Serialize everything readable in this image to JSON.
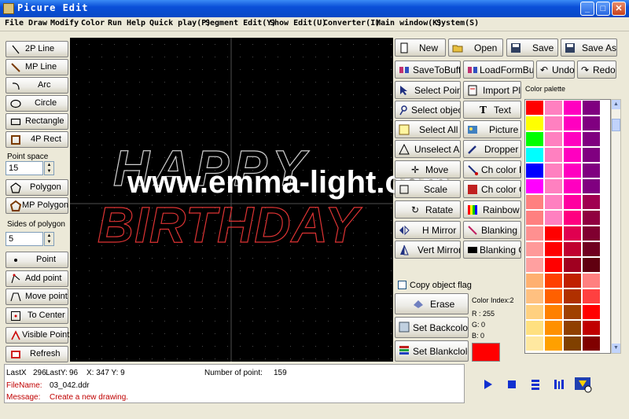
{
  "window": {
    "title": "Picure Edit",
    "minimize": "_",
    "maximize": "□",
    "close": "✕"
  },
  "menu": [
    "File",
    "Draw",
    "Modify",
    "Color",
    "Run",
    "Help",
    "Quick play(P)",
    "Segment Edit(Y)",
    "Show Edit(U)",
    "Converter(I)",
    "Main window(K)",
    "System(S)"
  ],
  "left_tools": {
    "line2p": "2P Line",
    "mpline": "MP Line",
    "arc": "Arc",
    "circle": "Circle",
    "rectangle": "Rectangle",
    "rect4p": "4P Rect",
    "point_space_label": "Point space",
    "point_space_value": "15",
    "polygon": "Polygon",
    "mp_polygon": "MP Polygon",
    "sides_label": "Sides of polygon",
    "sides_value": "5",
    "point": "Point",
    "add_point": "Add point",
    "move_point": "Move point",
    "to_center": "To Center",
    "visible_point": "Visible Point",
    "refresh": "Refresh"
  },
  "right_tools": {
    "new": "New",
    "open": "Open",
    "save": "Save",
    "save_as": "Save As",
    "save_to_buff": "SaveToBuff",
    "load_form_buff": "LoadFormBuff",
    "undo": "Undo",
    "redo": "Redo",
    "select_point": "Select Point",
    "import_plt": "Import Plt",
    "select_object": "Select object",
    "text": "Text",
    "select_all": "Select All",
    "picture": "Picture",
    "unselect_all": "Unselect All",
    "dropper": "Dropper",
    "move": "Move",
    "ch_color_l": "Ch color L",
    "scale": "Scale",
    "ch_color_o": "Ch color O",
    "rotate": "Ratate",
    "rainbow": "Rainbow",
    "h_mirror": "H Mirror",
    "blanking_l": "Blanking L",
    "vert_mirror": "Vert Mirror",
    "blanking_o": "Blanking O",
    "copy_flag": "Copy object flag",
    "erase": "Erase",
    "set_backcolor": "Set Backcolor",
    "set_blankcolor": "Set Blankclolor"
  },
  "palette": {
    "label": "Color palette",
    "columns": [
      [
        "#ff0000",
        "#ffff00",
        "#00ff00",
        "#00ffff",
        "#0000ff",
        "#ff00ff",
        "#ff8080",
        "#ff8080",
        "#ff9090",
        "#ff9999",
        "#ffa0a0",
        "#ffb070",
        "#ffc080",
        "#ffd080",
        "#ffe080",
        "#ffe8a0"
      ],
      [
        "#ff80c0",
        "#ff80c0",
        "#ff80c0",
        "#ff80c0",
        "#ff80c0",
        "#ff80c0",
        "#ff80c0",
        "#ff80c0",
        "#ff0000",
        "#ff0000",
        "#ff0000",
        "#ff4000",
        "#ff6000",
        "#ff8000",
        "#ff9000",
        "#ffa000"
      ],
      [
        "#ff00c0",
        "#ff00c0",
        "#ff00c0",
        "#ff00c0",
        "#ff00c0",
        "#ff00c0",
        "#ff00a0",
        "#ff0080",
        "#e00050",
        "#c00030",
        "#a00020",
        "#c02000",
        "#b03000",
        "#a04000",
        "#904000",
        "#804000"
      ],
      [
        "#800080",
        "#800080",
        "#800080",
        "#800080",
        "#800080",
        "#800080",
        "#a00050",
        "#900040",
        "#800030",
        "#700020",
        "#600010",
        "#ff8080",
        "#ff4040",
        "#ff0000",
        "#c00000",
        "#800000"
      ]
    ]
  },
  "color_info": {
    "index": "Color Index:2",
    "r": "R : 255",
    "g": "G:  0",
    "b": "B:  0",
    "current": "#ff0000"
  },
  "status": {
    "lastx": "LastX",
    "lastx_val": "296",
    "lasty": "LastY:",
    "lasty_val": "96",
    "xy": "X: 347  Y: 9",
    "num_points_label": "Number of point:",
    "num_points": "159",
    "filename_label": "FileName:",
    "filename": "03_042.ddr",
    "message_label": "Message:",
    "message": "Create a new drawing."
  },
  "watermark": "www.emma-light.com",
  "canvas": {
    "line1": "HAPPY",
    "line2": "BIRTHDAY",
    "grid_color": "#4a4a4a"
  }
}
